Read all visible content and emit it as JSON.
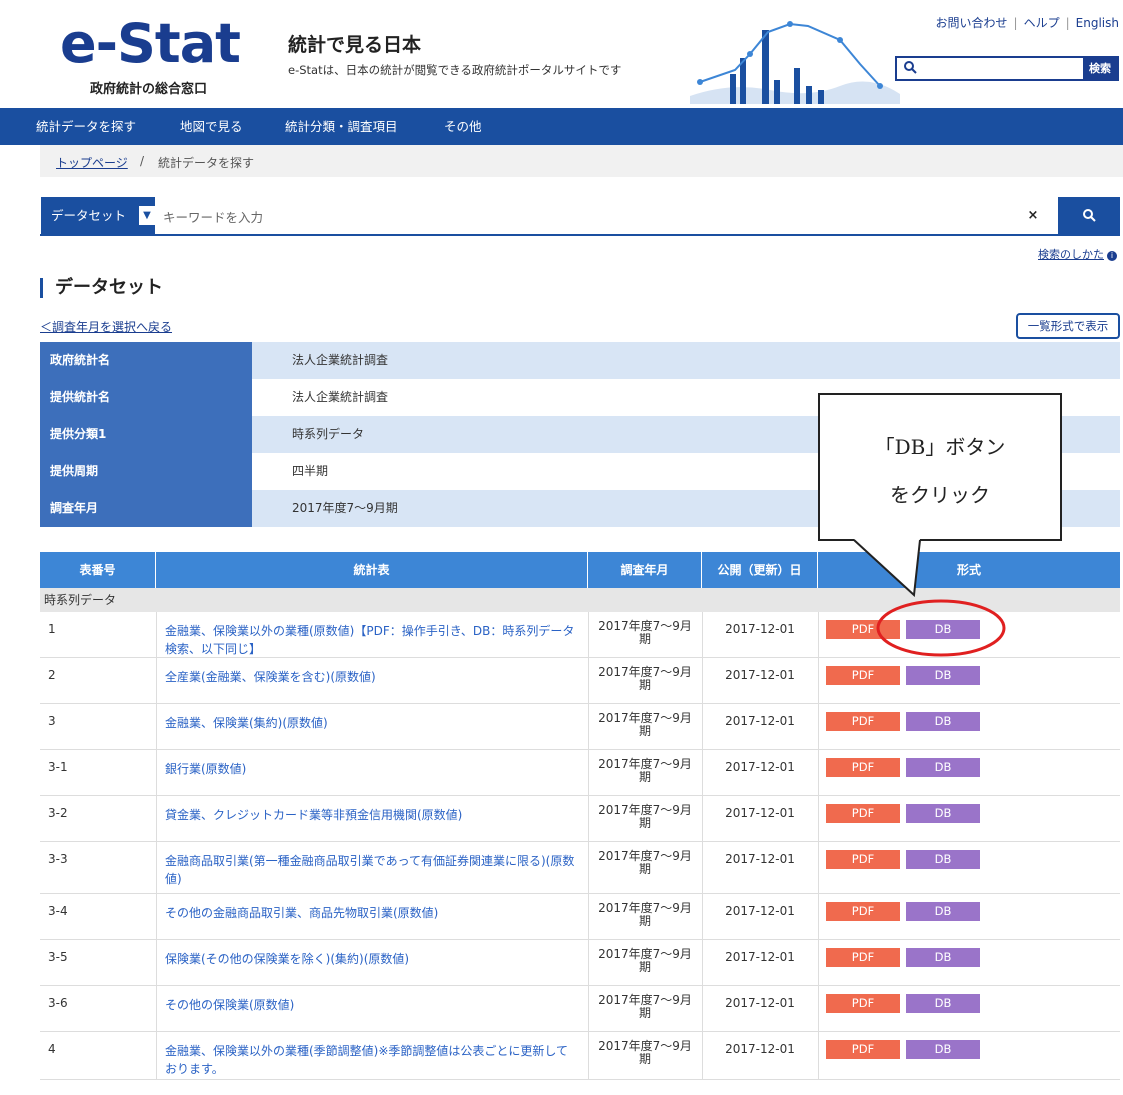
{
  "header": {
    "logo_text": "e-Stat",
    "logo_sub": "政府統計の総合窓口",
    "site_title": "統計で見る日本",
    "site_desc": "e-Statは、日本の統計が閲覧できる政府統計ポータルサイトです",
    "util_links": [
      "お問い合わせ",
      "ヘルプ",
      "English"
    ],
    "search_button": "検索"
  },
  "nav": [
    "統計データを探す",
    "地図で見る",
    "統計分類・調査項目",
    "その他"
  ],
  "breadcrumb": {
    "home": "トップページ",
    "sep": "/",
    "current": "統計データを探す"
  },
  "search": {
    "scope": "データセット",
    "placeholder": "キーワードを入力",
    "clear": "×",
    "howto": "検索のしかた"
  },
  "section": {
    "title": "データセット",
    "back_link": "＜調査年月を選択へ戻る",
    "list_view": "一覧形式で表示"
  },
  "info": [
    {
      "key": "政府統計名",
      "value": "法人企業統計調査"
    },
    {
      "key": "提供統計名",
      "value": "法人企業統計調査"
    },
    {
      "key": "提供分類1",
      "value": "時系列データ"
    },
    {
      "key": "提供周期",
      "value": "四半期"
    },
    {
      "key": "調査年月",
      "value": "2017年度7～9月期"
    }
  ],
  "callout": {
    "line1": "「DB」ボタン",
    "line2": "をクリック"
  },
  "table": {
    "headers": {
      "no": "表番号",
      "title": "統計表",
      "month": "調査年月",
      "date": "公開（更新）日",
      "format": "形式"
    },
    "group": "時系列データ",
    "pdf_label": "PDF",
    "db_label": "DB",
    "rows": [
      {
        "no": "1",
        "title": "金融業、保険業以外の業種(原数値)【PDF：操作手引き、DB：時系列データ検索、以下同じ】",
        "month1": "2017年度7～9月",
        "month2": "期",
        "date": "2017-12-01"
      },
      {
        "no": "2",
        "title": "全産業(金融業、保険業を含む)(原数値)",
        "month1": "2017年度7～9月",
        "month2": "期",
        "date": "2017-12-01"
      },
      {
        "no": "3",
        "title": "金融業、保険業(集約)(原数値)",
        "month1": "2017年度7～9月",
        "month2": "期",
        "date": "2017-12-01"
      },
      {
        "no": "3-1",
        "title": "銀行業(原数値)",
        "month1": "2017年度7～9月",
        "month2": "期",
        "date": "2017-12-01"
      },
      {
        "no": "3-2",
        "title": "貸金業、クレジットカード業等非預金信用機関(原数値)",
        "month1": "2017年度7～9月",
        "month2": "期",
        "date": "2017-12-01"
      },
      {
        "no": "3-3",
        "title": "金融商品取引業(第一種金融商品取引業であって有価証券関連業に限る)(原数値)",
        "month1": "2017年度7～9月",
        "month2": "期",
        "date": "2017-12-01"
      },
      {
        "no": "3-4",
        "title": "その他の金融商品取引業、商品先物取引業(原数値)",
        "month1": "2017年度7～9月",
        "month2": "期",
        "date": "2017-12-01"
      },
      {
        "no": "3-5",
        "title": "保険業(その他の保険業を除く)(集約)(原数値)",
        "month1": "2017年度7～9月",
        "month2": "期",
        "date": "2017-12-01"
      },
      {
        "no": "3-6",
        "title": "その他の保険業(原数値)",
        "month1": "2017年度7～9月",
        "month2": "期",
        "date": "2017-12-01"
      },
      {
        "no": "4",
        "title": "金融業、保険業以外の業種(季節調整値)※季節調整値は公表ごとに更新しております。",
        "month1": "2017年度7～9月",
        "month2": "期",
        "date": "2017-12-01"
      }
    ]
  },
  "colors": {
    "brand": "#1a4fa0",
    "pdf": "#f06a4e",
    "db": "#9a74c9",
    "highlight": "#e02020"
  }
}
